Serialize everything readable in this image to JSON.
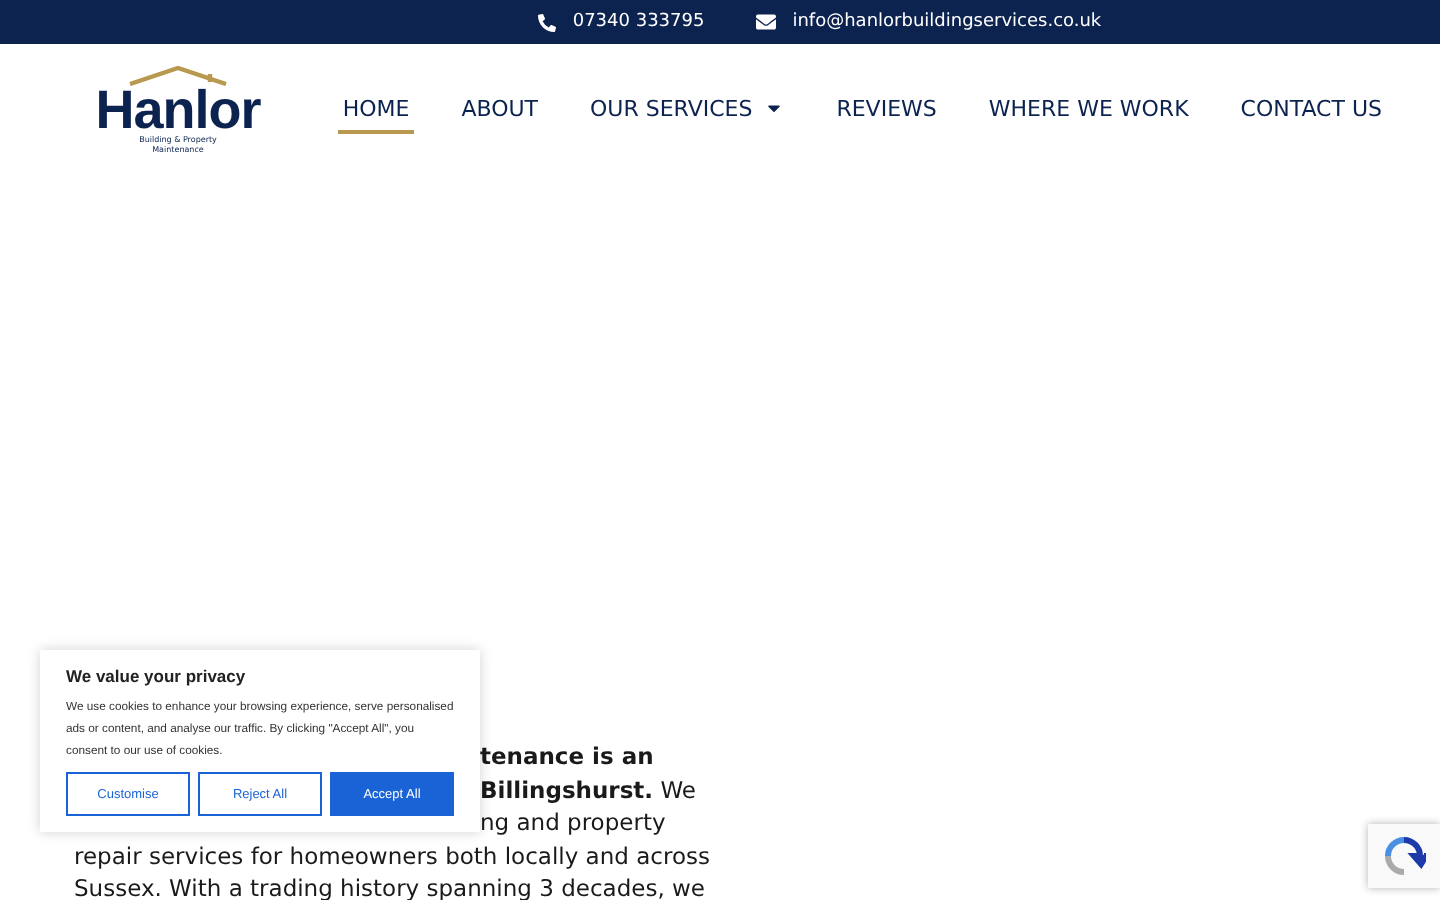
{
  "top_bar": {
    "phone": "07340 333795",
    "email": "info@hanlorbuildingservices.co.uk"
  },
  "logo": {
    "name": "Hanlor",
    "tagline": "Building & Property",
    "tagline_2": "Maintenance"
  },
  "nav": [
    {
      "label": "HOME",
      "selected": true,
      "dropdown": false
    },
    {
      "label": "ABOUT",
      "selected": false,
      "dropdown": false
    },
    {
      "label": "OUR SERVICES",
      "selected": false,
      "dropdown": true
    },
    {
      "label": "REVIEWS",
      "selected": false,
      "dropdown": false
    },
    {
      "label": "WHERE WE WORK",
      "selected": false,
      "dropdown": false
    },
    {
      "label": "CONTACT US",
      "selected": false,
      "dropdown": false
    }
  ],
  "intro_lines": [
    {
      "text": "**tenance is an**",
      "partial": true
    },
    {
      "text": "**Billingshurst.** We",
      "partial": true
    },
    {
      "text": "ng and property",
      "partial": true
    },
    {
      "text": "repair services for homeowners both locally and across",
      "partial": false
    },
    {
      "text": "Sussex. With a trading history spanning 3 decades, we",
      "partial": false
    }
  ],
  "cookie_banner": {
    "title": "We value your privacy",
    "body": "We use cookies to enhance your browsing experience, serve personalised ads or content, and analyse our traffic. By clicking \"Accept All\", you consent to our use of cookies.",
    "buttons": [
      {
        "label": "Customise",
        "kind": "outline"
      },
      {
        "label": "Reject All",
        "kind": "outline"
      },
      {
        "label": "Accept All",
        "kind": "primary"
      }
    ]
  }
}
